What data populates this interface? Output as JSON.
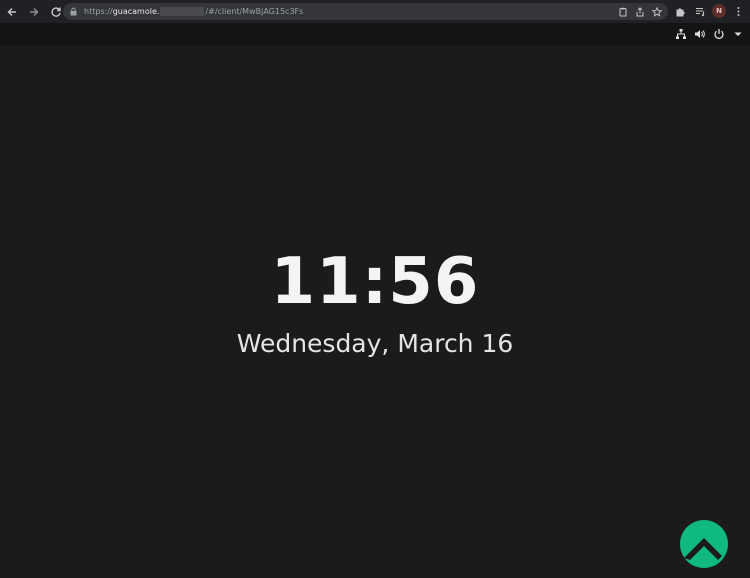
{
  "browser": {
    "url_scheme": "https://",
    "url_host": "guacamole.",
    "url_path": "/#/client/MwBjAG15c3Fs",
    "profile_initial": "N"
  },
  "icons": {
    "back": "arrow-left-icon",
    "forward": "arrow-right-icon",
    "reload": "reload-icon",
    "lock": "lock-icon",
    "clipboard": "clipboard-icon",
    "share": "share-icon",
    "bookmark": "star-icon",
    "extensions": "puzzle-icon",
    "media": "media-list-icon",
    "menu": "kebab-menu-icon",
    "network": "network-icon",
    "volume": "volume-icon",
    "power": "power-icon",
    "dropdown": "caret-down-icon",
    "distro_logo": "rocky-linux-logo"
  },
  "lock_screen": {
    "time": "11:56",
    "date": "Wednesday, March 16"
  },
  "colors": {
    "background": "#1b1b1d",
    "logo_green": "#10b981"
  }
}
